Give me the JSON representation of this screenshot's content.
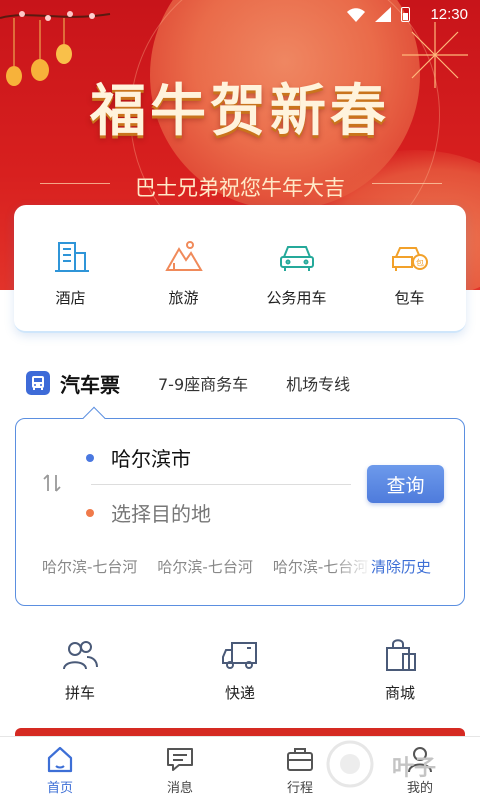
{
  "status_bar": {
    "time": "12:30"
  },
  "banner": {
    "title": "福牛贺新春",
    "subtitle": "巴士兄弟祝您牛年大吉"
  },
  "services": [
    {
      "label": "酒店",
      "icon": "hotel-icon"
    },
    {
      "label": "旅游",
      "icon": "mountain-icon"
    },
    {
      "label": "公务用车",
      "icon": "car-icon"
    },
    {
      "label": "包车",
      "icon": "charter-car-icon"
    }
  ],
  "ticket_tabs": {
    "active": "汽车票",
    "others": [
      "7-9座商务车",
      "机场专线"
    ]
  },
  "search": {
    "from_city": "哈尔滨市",
    "to_placeholder": "选择目的地",
    "query_label": "查询",
    "history": [
      "哈尔滨-七台河",
      "哈尔滨-七台河",
      "哈尔滨-七台河"
    ],
    "clear_history_label": "清除历史"
  },
  "quick_entries": [
    {
      "label": "拼车",
      "icon": "people-icon"
    },
    {
      "label": "快递",
      "icon": "delivery-truck-icon"
    },
    {
      "label": "商城",
      "icon": "shopping-bag-icon"
    }
  ],
  "bottom_nav": [
    {
      "label": "首页",
      "icon": "home-icon",
      "active": true
    },
    {
      "label": "消息",
      "icon": "message-icon",
      "active": false
    },
    {
      "label": "行程",
      "icon": "briefcase-icon",
      "active": false
    },
    {
      "label": "我的",
      "icon": "user-icon",
      "active": false
    }
  ],
  "watermark": "叶子",
  "colors": {
    "banner_red": "#d8201f",
    "accent_blue": "#3d6fd6",
    "from_dot": "#4a78e0",
    "to_dot": "#f07a4a"
  }
}
